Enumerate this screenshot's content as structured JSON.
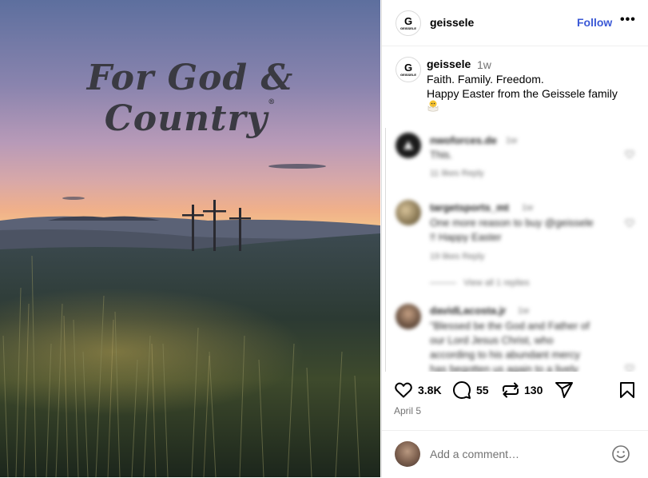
{
  "photo": {
    "title": "For God & Country",
    "registered_mark": "®"
  },
  "header": {
    "avatar_letter": "G",
    "avatar_word": "GEISSELE",
    "username": "geissele",
    "follow_label": "Follow",
    "more_icon": "more-horizontal-icon"
  },
  "caption": {
    "username": "geissele",
    "time": "1w",
    "line1": "Faith. Family. Freedom.",
    "line2": "Happy Easter from the Geissele family",
    "emoji_icon": "hatching-chick-icon"
  },
  "comments": [
    {
      "username": "nwoforces.de",
      "time": "1w",
      "lines": [
        "This."
      ],
      "meta": "11 likes   Reply"
    },
    {
      "username": "targetsports_mt",
      "time": "1w",
      "lines": [
        "One more reason to buy @geissele",
        "!! Happy Easter"
      ],
      "meta": "19 likes   Reply",
      "view_replies": "View all 1 replies"
    },
    {
      "username": "davidLacosta.jr",
      "time": "1w",
      "lines": [
        "\"Blessed be the God and Father of",
        "our Lord Jesus Christ, who",
        "according to his abundant mercy",
        "has begotten us again to a lively"
      ],
      "meta": ""
    }
  ],
  "actions": {
    "likes": "3.8K",
    "comments": "55",
    "reposts": "130",
    "date": "April 5"
  },
  "comment_bar": {
    "placeholder": "Add a comment…"
  },
  "colors": {
    "follow": "#3b59d6",
    "muted": "#737373",
    "border": "#dbdbdb"
  }
}
